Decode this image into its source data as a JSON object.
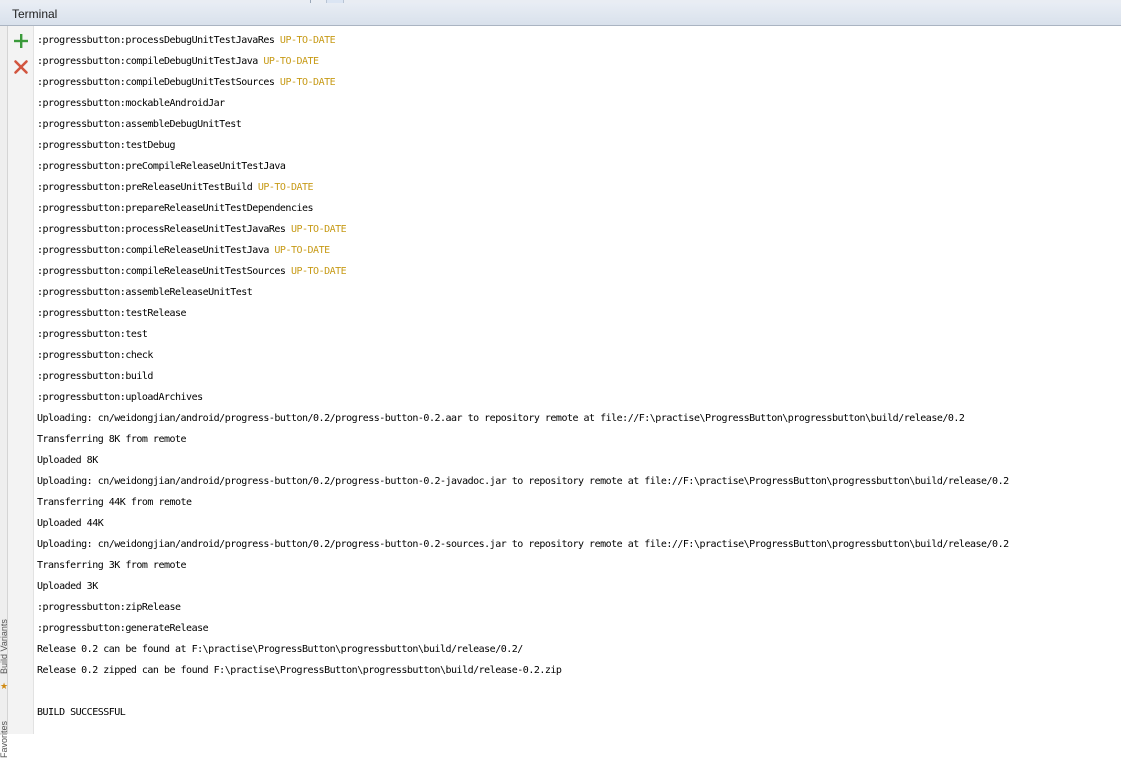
{
  "panel": {
    "title": "Terminal"
  },
  "sidebar": {
    "favorites_label": "Favorites",
    "build_variants_label": "Build Variants"
  },
  "toolbar": {
    "add_icon": "plus-icon",
    "close_icon": "close-icon",
    "add_color": "#3a9a3a",
    "close_color": "#d2553f"
  },
  "status_color": "#c79a16",
  "console": {
    "lines": [
      {
        "text": ":progressbutton:processDebugUnitTestJavaRes",
        "status": "UP-TO-DATE"
      },
      {
        "text": ":progressbutton:compileDebugUnitTestJava",
        "status": "UP-TO-DATE"
      },
      {
        "text": ":progressbutton:compileDebugUnitTestSources",
        "status": "UP-TO-DATE"
      },
      {
        "text": ":progressbutton:mockableAndroidJar",
        "status": ""
      },
      {
        "text": ":progressbutton:assembleDebugUnitTest",
        "status": ""
      },
      {
        "text": ":progressbutton:testDebug",
        "status": ""
      },
      {
        "text": ":progressbutton:preCompileReleaseUnitTestJava",
        "status": ""
      },
      {
        "text": ":progressbutton:preReleaseUnitTestBuild",
        "status": "UP-TO-DATE"
      },
      {
        "text": ":progressbutton:prepareReleaseUnitTestDependencies",
        "status": ""
      },
      {
        "text": ":progressbutton:processReleaseUnitTestJavaRes",
        "status": "UP-TO-DATE"
      },
      {
        "text": ":progressbutton:compileReleaseUnitTestJava",
        "status": "UP-TO-DATE"
      },
      {
        "text": ":progressbutton:compileReleaseUnitTestSources",
        "status": "UP-TO-DATE"
      },
      {
        "text": ":progressbutton:assembleReleaseUnitTest",
        "status": ""
      },
      {
        "text": ":progressbutton:testRelease",
        "status": ""
      },
      {
        "text": ":progressbutton:test",
        "status": ""
      },
      {
        "text": ":progressbutton:check",
        "status": ""
      },
      {
        "text": ":progressbutton:build",
        "status": ""
      },
      {
        "text": ":progressbutton:uploadArchives",
        "status": ""
      },
      {
        "text": "Uploading: cn/weidongjian/android/progress-button/0.2/progress-button-0.2.aar to repository remote at file://F:\\practise\\ProgressButton\\progressbutton\\build/release/0.2",
        "status": ""
      },
      {
        "text": "Transferring 8K from remote",
        "status": ""
      },
      {
        "text": "Uploaded 8K",
        "status": ""
      },
      {
        "text": "Uploading: cn/weidongjian/android/progress-button/0.2/progress-button-0.2-javadoc.jar to repository remote at file://F:\\practise\\ProgressButton\\progressbutton\\build/release/0.2",
        "status": ""
      },
      {
        "text": "Transferring 44K from remote",
        "status": ""
      },
      {
        "text": "Uploaded 44K",
        "status": ""
      },
      {
        "text": "Uploading: cn/weidongjian/android/progress-button/0.2/progress-button-0.2-sources.jar to repository remote at file://F:\\practise\\ProgressButton\\progressbutton\\build/release/0.2",
        "status": ""
      },
      {
        "text": "Transferring 3K from remote",
        "status": ""
      },
      {
        "text": "Uploaded 3K",
        "status": ""
      },
      {
        "text": ":progressbutton:zipRelease",
        "status": ""
      },
      {
        "text": ":progressbutton:generateRelease",
        "status": ""
      },
      {
        "text": "Release 0.2 can be found at F:\\practise\\ProgressButton\\progressbutton\\build/release/0.2/",
        "status": ""
      },
      {
        "text": "Release 0.2 zipped can be found F:\\practise\\ProgressButton\\progressbutton\\build/release-0.2.zip",
        "status": ""
      },
      {
        "text": "",
        "status": ""
      },
      {
        "text": "BUILD SUCCESSFUL",
        "status": ""
      }
    ]
  }
}
